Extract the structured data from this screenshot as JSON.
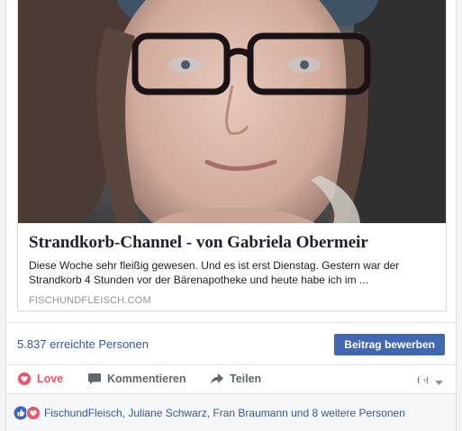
{
  "card": {
    "title": "Strandkorb-Channel - von Gabriela Obermeir",
    "description": "Diese Woche sehr fleißig gewesen. Und es ist erst Dienstag. Gestern war der Strandkorb 4 Stunden vor der Bärenapotheke und heute habe ich im ...",
    "domain": "FISCHUNDFLEISCH.COM",
    "image_icon": "person-photo"
  },
  "stats": {
    "reach": "5.837 erreichte Personen",
    "boost_label": "Beitrag bewerben"
  },
  "actions": {
    "love_label": "Love",
    "comment_label": "Kommentieren",
    "share_label": "Teilen"
  },
  "reactions": {
    "names": "FischundFleisch, Juliane Schwarz, Fran Braumann und 8 weitere Personen",
    "icons": [
      "like-reaction-icon",
      "love-reaction-icon"
    ]
  },
  "colors": {
    "link": "#365899",
    "primary_button": "#4267b2",
    "love": "#f25268"
  }
}
